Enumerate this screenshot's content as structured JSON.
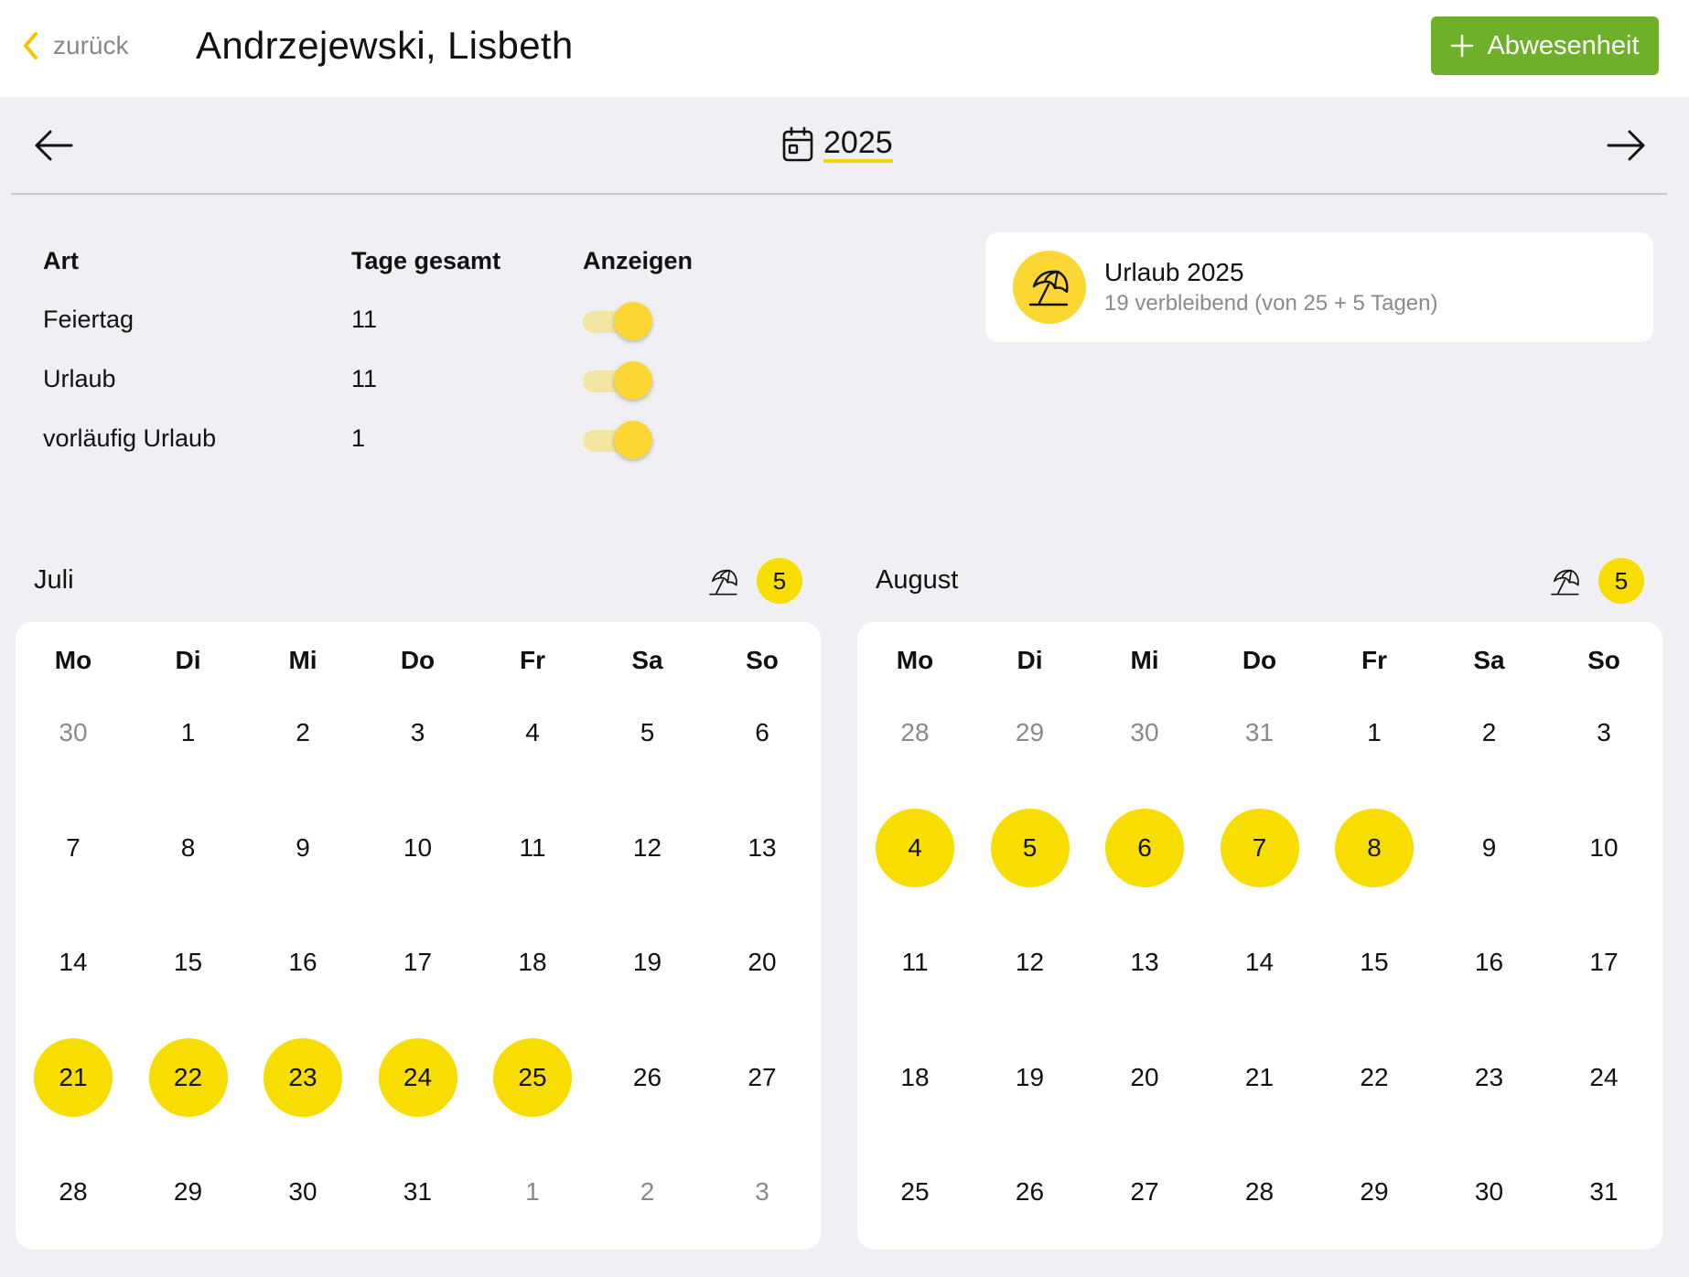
{
  "header": {
    "back_label": "zurück",
    "title": "Andrzejewski, Lisbeth",
    "add_label": "Abwesenheit"
  },
  "year_nav": {
    "year": "2025"
  },
  "types_table": {
    "columns": [
      "Art",
      "Tage gesamt",
      "Anzeigen"
    ],
    "rows": [
      {
        "type": "Feiertag",
        "days": "11",
        "shown": true
      },
      {
        "type": "Urlaub",
        "days": "11",
        "shown": true
      },
      {
        "type": "vorläufig Urlaub",
        "days": "1",
        "shown": true
      }
    ]
  },
  "vacation_card": {
    "title": "Urlaub 2025",
    "subtitle": "19 verbleibend (von 25 + 5 Tagen)"
  },
  "weekdays": [
    "Mo",
    "Di",
    "Mi",
    "Do",
    "Fr",
    "Sa",
    "So"
  ],
  "months": [
    {
      "name": "Juli",
      "vacation_count": "5",
      "weeks": [
        [
          "30",
          "1",
          "2",
          "3",
          "4",
          "5",
          "6"
        ],
        [
          "7",
          "8",
          "9",
          "10",
          "11",
          "12",
          "13"
        ],
        [
          "14",
          "15",
          "16",
          "17",
          "18",
          "19",
          "20"
        ],
        [
          "21",
          "22",
          "23",
          "24",
          "25",
          "26",
          "27"
        ],
        [
          "28",
          "29",
          "30",
          "31",
          "1",
          "2",
          "3"
        ]
      ],
      "other_month": [
        [
          0,
          0
        ],
        [
          4,
          4
        ],
        [
          4,
          5
        ],
        [
          4,
          6
        ]
      ],
      "highlighted": [
        [
          3,
          0
        ],
        [
          3,
          1
        ],
        [
          3,
          2
        ],
        [
          3,
          3
        ],
        [
          3,
          4
        ]
      ]
    },
    {
      "name": "August",
      "vacation_count": "5",
      "weeks": [
        [
          "28",
          "29",
          "30",
          "31",
          "1",
          "2",
          "3"
        ],
        [
          "4",
          "5",
          "6",
          "7",
          "8",
          "9",
          "10"
        ],
        [
          "11",
          "12",
          "13",
          "14",
          "15",
          "16",
          "17"
        ],
        [
          "18",
          "19",
          "20",
          "21",
          "22",
          "23",
          "24"
        ],
        [
          "25",
          "26",
          "27",
          "28",
          "29",
          "30",
          "31"
        ]
      ],
      "other_month": [
        [
          0,
          0
        ],
        [
          0,
          1
        ],
        [
          0,
          2
        ],
        [
          0,
          3
        ]
      ],
      "highlighted": [
        [
          1,
          0
        ],
        [
          1,
          1
        ],
        [
          1,
          2
        ],
        [
          1,
          3
        ],
        [
          1,
          4
        ]
      ]
    }
  ],
  "colors": {
    "accent_green": "#6fb02a",
    "highlight_yellow": "#f7dd00",
    "toggle_yellow": "#fcd733"
  }
}
